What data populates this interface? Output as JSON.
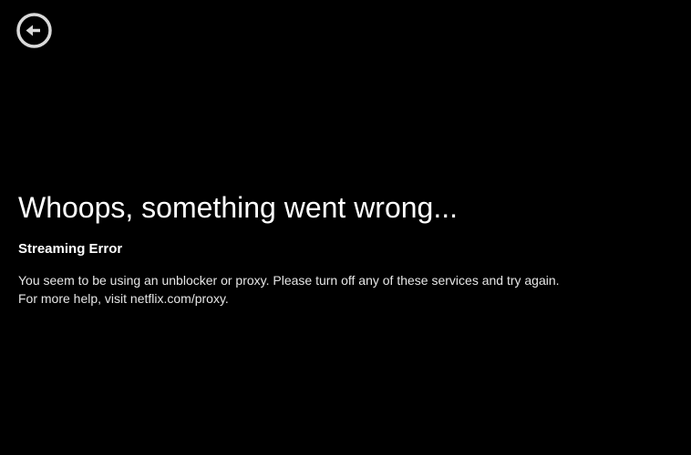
{
  "back_button": {
    "icon": "back-arrow-circle-icon"
  },
  "error": {
    "title": "Whoops, something went wrong...",
    "subtitle": "Streaming Error",
    "message": "You seem to be using an unblocker or proxy. Please turn off any of these services and try again. For more help, visit netflix.com/proxy."
  },
  "colors": {
    "background": "#000000",
    "text": "#ffffff",
    "icon": "#d9d9d9"
  }
}
